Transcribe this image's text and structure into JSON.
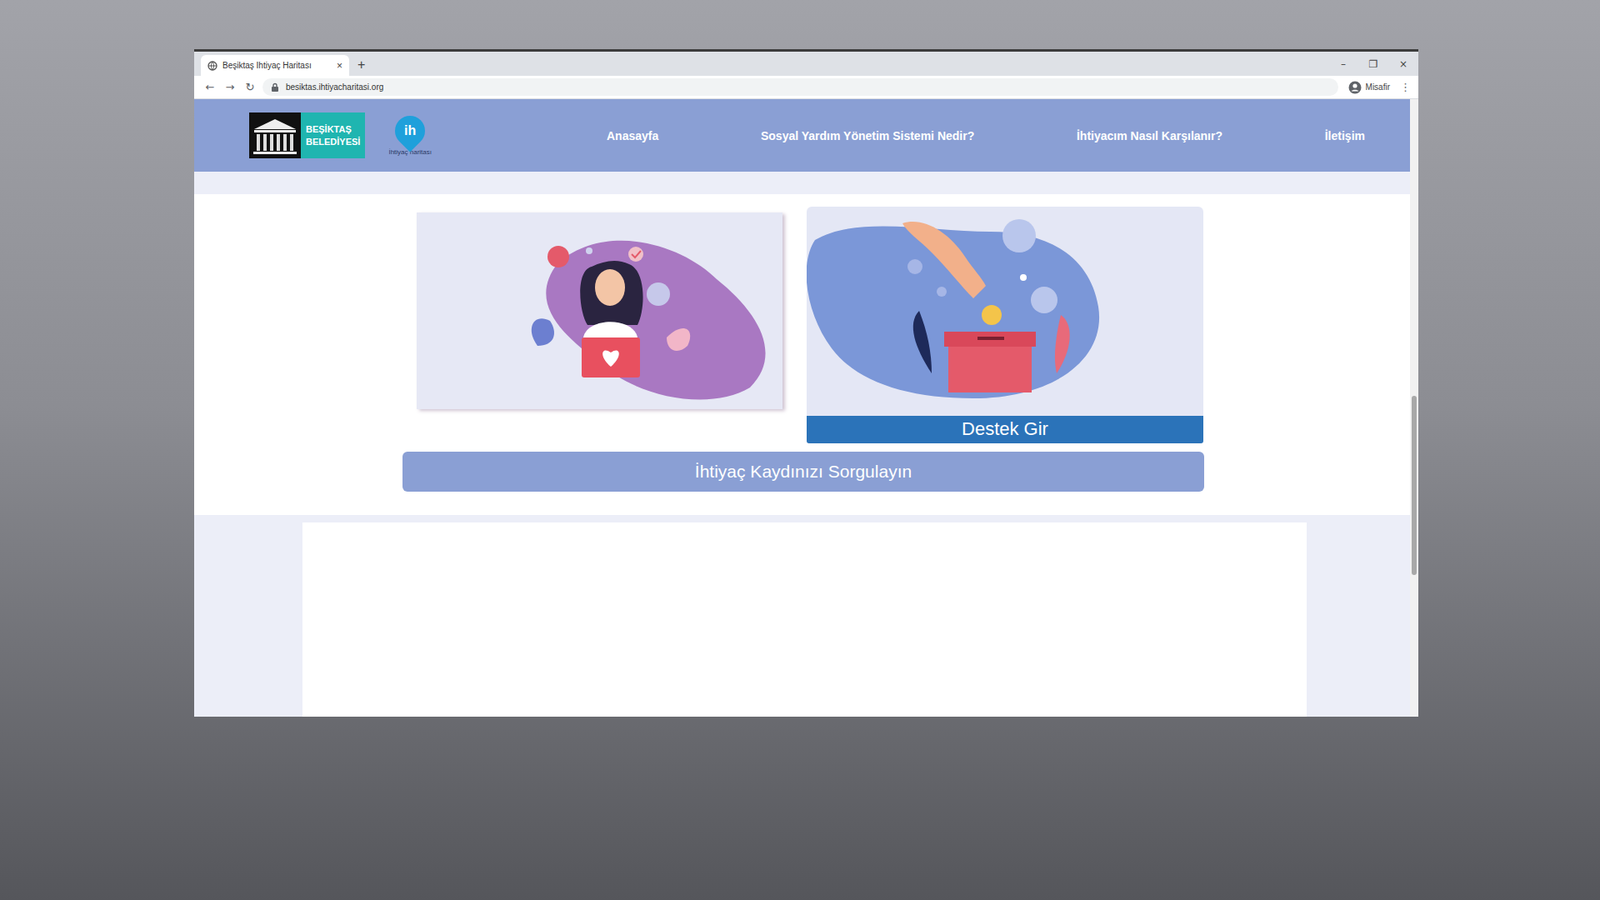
{
  "browser": {
    "tabs": [
      {
        "title": "Beşiktaş İhtiyaç Haritası",
        "close": "×",
        "selected": true
      }
    ],
    "new_tab": "+",
    "window_controls": [
      "–",
      "❐",
      "×"
    ],
    "nav_buttons": [
      "←",
      "→",
      "↻"
    ],
    "address": "besiktas.ihtiyacharitasi.org",
    "profile": "Misafir",
    "menu": "⋮"
  },
  "site": {
    "municipality_logo": [
      "BEŞİKTAŞ",
      "BELEDİYESİ"
    ],
    "map_logo": {
      "mark": "ih",
      "caption": "İhtiyaç haritası"
    },
    "nav": [
      "Anasayfa",
      "Sosyal Yardım Yönetim Sistemi Nedir?",
      "İhtiyacım Nasıl Karşılanır?",
      "İletişim"
    ],
    "support_card": {
      "label": "Destek Gir"
    },
    "query_button": "İhtiyaç Kaydınızı Sorgulayın"
  },
  "scrollbar": {
    "offset": 0.48,
    "size": 0.29
  }
}
